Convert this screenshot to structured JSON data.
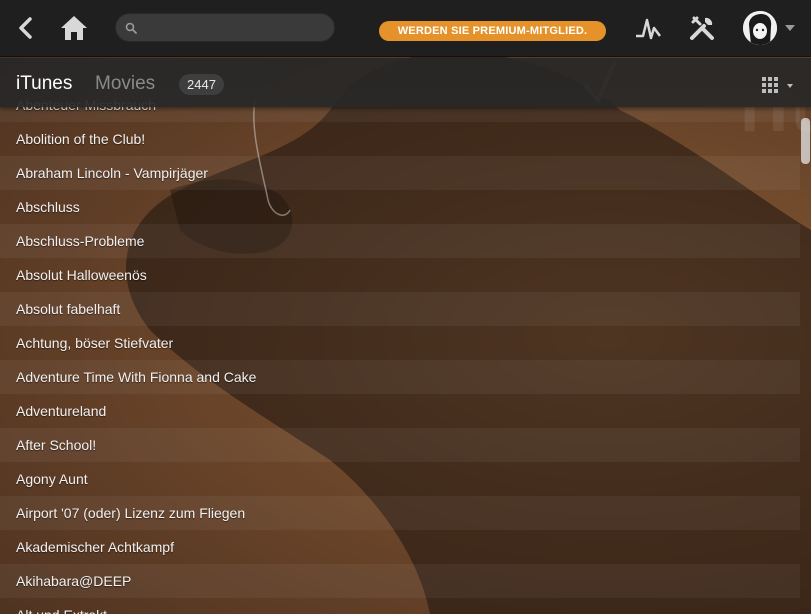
{
  "header": {
    "search": {
      "placeholder": "",
      "value": ""
    },
    "premium_label": "WERDEN SIE PREMIUM-MITGLIED.",
    "icons": {
      "back": "back-arrow-icon",
      "home": "home-icon",
      "search": "search-icon",
      "activity": "activity-icon",
      "tools": "tools-icon",
      "avatar": "avatar",
      "avatar_menu": "chevron-down-icon"
    },
    "colors": {
      "premium": "#e5922a",
      "topbar": "#1f1f1f"
    }
  },
  "subbar": {
    "source_tab": "iTunes",
    "section_tab": "Movies",
    "count": "2447",
    "view_icon": "grid-view-icon"
  },
  "background": {
    "watermark": "iTu"
  },
  "movies": [
    "Abenteuer Missbrauch",
    "Abolition of the Club!",
    "Abraham Lincoln - Vampirjäger",
    "Abschluss",
    "Abschluss-Probleme",
    "Absolut Halloweenös",
    "Absolut fabelhaft",
    "Achtung, böser Stiefvater",
    "Adventure Time With Fionna and Cake",
    "Adventureland",
    "After School!",
    "Agony Aunt",
    "Airport '07 (oder) Lizenz zum Fliegen",
    "Akademischer Achtkampf",
    "Akihabara@DEEP",
    "Alt und Extrakt"
  ]
}
